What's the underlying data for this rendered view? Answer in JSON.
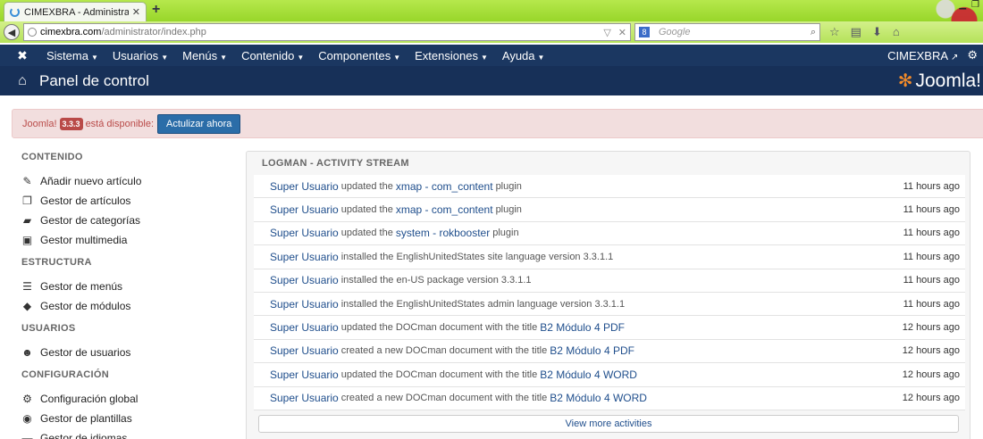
{
  "browser": {
    "tab_title": "CIMEXBRA - Administració...",
    "tab_close": "✕",
    "new_tab": "+",
    "url_host": "cimexbra.com",
    "url_path": "/administrator/index.php",
    "search_placeholder": "Google",
    "search_engine_letter": "8"
  },
  "topnav": {
    "menus": [
      {
        "label": "Sistema"
      },
      {
        "label": "Usuarios"
      },
      {
        "label": "Menús"
      },
      {
        "label": "Contenido"
      },
      {
        "label": "Componentes"
      },
      {
        "label": "Extensiones"
      },
      {
        "label": "Ayuda"
      }
    ],
    "site_label": "CIMEXBRA"
  },
  "header": {
    "title": "Panel de control",
    "brand": "Joomla!"
  },
  "alert": {
    "prefix": "Joomla!",
    "version": "3.3.3",
    "suffix": "está disponible:",
    "button": "Actulizar ahora"
  },
  "sidebar": {
    "sections": [
      {
        "title": "CONTENIDO",
        "items": [
          {
            "label": "Añadir nuevo artículo",
            "icon": "pencil-icon"
          },
          {
            "label": "Gestor de artículos",
            "icon": "stack-icon"
          },
          {
            "label": "Gestor de categorías",
            "icon": "folder-icon"
          },
          {
            "label": "Gestor multimedia",
            "icon": "image-icon"
          }
        ]
      },
      {
        "title": "ESTRUCTURA",
        "items": [
          {
            "label": "Gestor de menús",
            "icon": "list-icon"
          },
          {
            "label": "Gestor de módulos",
            "icon": "cube-icon"
          }
        ]
      },
      {
        "title": "USUARIOS",
        "items": [
          {
            "label": "Gestor de usuarios",
            "icon": "users-icon"
          }
        ]
      },
      {
        "title": "CONFIGURACIÓN",
        "items": [
          {
            "label": "Configuración global",
            "icon": "cog-icon"
          },
          {
            "label": "Gestor de plantillas",
            "icon": "eye-icon"
          },
          {
            "label": "Gestor de idiomas",
            "icon": "comment-icon"
          }
        ]
      }
    ]
  },
  "activity": {
    "title": "LOGMAN - ACTIVITY STREAM",
    "rows": [
      {
        "actor": "Super Usuario",
        "verb": "updated the",
        "object": "xmap - com_content",
        "suffix": "plugin",
        "time": "11 hours ago"
      },
      {
        "actor": "Super Usuario",
        "verb": "updated the",
        "object": "xmap - com_content",
        "suffix": "plugin",
        "time": "11 hours ago"
      },
      {
        "actor": "Super Usuario",
        "verb": "updated the",
        "object": "system - rokbooster",
        "suffix": "plugin",
        "time": "11 hours ago"
      },
      {
        "actor": "Super Usuario",
        "verb": "installed the EnglishUnitedStates site language version 3.3.1.1",
        "object": "",
        "suffix": "",
        "time": "11 hours ago"
      },
      {
        "actor": "Super Usuario",
        "verb": "installed the en-US package version 3.3.1.1",
        "object": "",
        "suffix": "",
        "time": "11 hours ago"
      },
      {
        "actor": "Super Usuario",
        "verb": "installed the EnglishUnitedStates admin language version 3.3.1.1",
        "object": "",
        "suffix": "",
        "time": "11 hours ago"
      },
      {
        "actor": "Super Usuario",
        "verb": "updated the DOCman document with the title",
        "object": "B2 Módulo 4 PDF",
        "suffix": "",
        "time": "12 hours ago"
      },
      {
        "actor": "Super Usuario",
        "verb": "created a new DOCman document with the title",
        "object": "B2 Módulo 4 PDF",
        "suffix": "",
        "time": "12 hours ago"
      },
      {
        "actor": "Super Usuario",
        "verb": "updated the DOCman document with the title",
        "object": "B2 Módulo 4 WORD",
        "suffix": "",
        "time": "12 hours ago"
      },
      {
        "actor": "Super Usuario",
        "verb": "created a new DOCman document with the title",
        "object": "B2 Módulo 4 WORD",
        "suffix": "",
        "time": "12 hours ago"
      }
    ],
    "more_label": "View more activities"
  }
}
